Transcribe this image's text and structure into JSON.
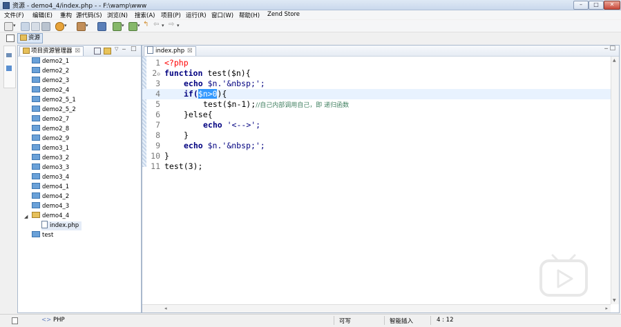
{
  "window": {
    "title": "资源 - demo4_4/index.php - - F:\\wamp\\www",
    "controls": {
      "minimize": "–",
      "maximize": "□",
      "close": "✕"
    }
  },
  "menu": [
    "文件(F)",
    "编辑(E)",
    "重构",
    "源代码(S)",
    "浏览(N)",
    "搜索(A)",
    "项目(P)",
    "运行(R)",
    "窗口(W)",
    "帮助(H)",
    "Zend Store"
  ],
  "perspective": {
    "label": "资源"
  },
  "explorer": {
    "tab_label": "项目资源管理器",
    "tab_close": "☒",
    "items": [
      "demo2_1",
      "demo2_2",
      "demo2_3",
      "demo2_4",
      "demo2_5_1",
      "demo2_5_2",
      "demo2_7",
      "demo2_8",
      "demo2_9",
      "demo3_1",
      "demo3_2",
      "demo3_3",
      "demo3_4",
      "demo4_1",
      "demo4_2",
      "demo4_3"
    ],
    "expanded_item": "demo4_4",
    "child_file": "index.php",
    "last_item": "test"
  },
  "editor": {
    "tab_label": "index.php",
    "tab_close": "☒",
    "lines": {
      "l1": "<?php",
      "l2_kw": "function",
      "l2_rest": " test($n){",
      "l3_kw": "echo",
      "l3_rest": " $n.'&nbsp;';",
      "l4_kw": "if(",
      "l4_sel": "$n>0",
      "l4_rest": "){",
      "l5_code": "test($n-1);",
      "l5_comment": "//自己内部调用自己，即 递归函数",
      "l6": "}else{",
      "l7_kw": "echo",
      "l7_rest": " '<-->';",
      "l8": "}",
      "l9_kw": "echo",
      "l9_rest": " $n.'&nbsp;';",
      "l10": "}",
      "l11": "test(3);"
    }
  },
  "status": {
    "language": "PHP",
    "language_prefix": "<>",
    "writable": "可写",
    "insert_mode": "智能插入",
    "position": "4 : 12"
  }
}
